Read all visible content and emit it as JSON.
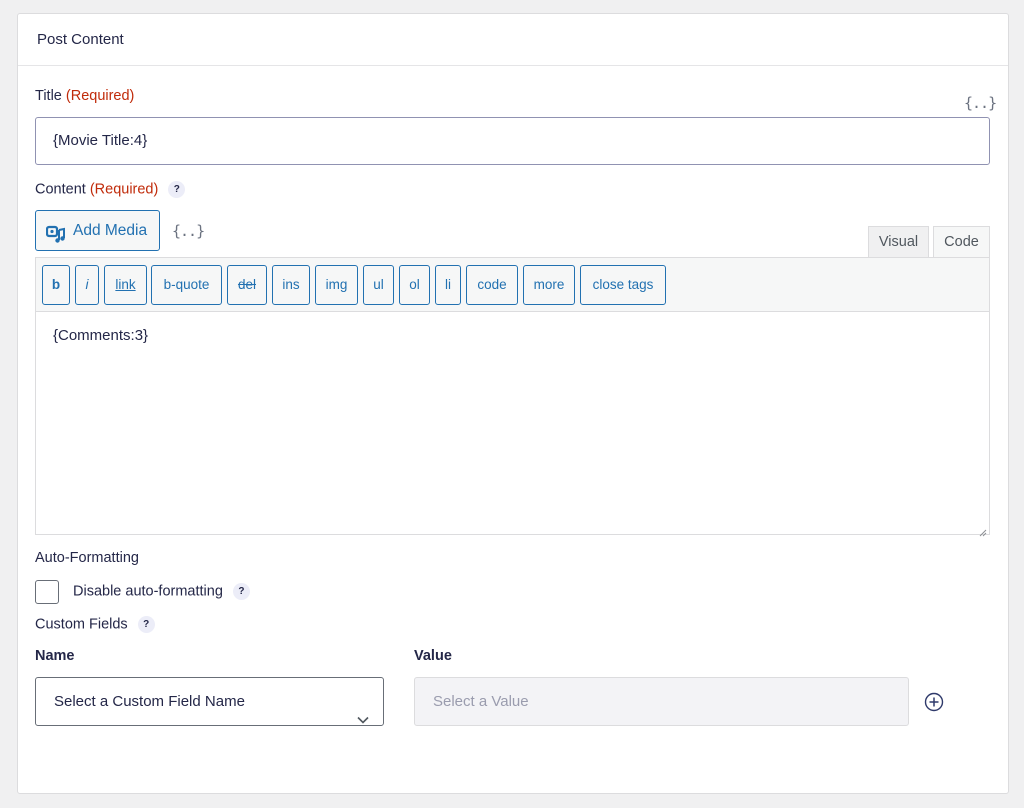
{
  "panel": {
    "title": "Post Content"
  },
  "title_field": {
    "label": "Title",
    "required": "(Required)",
    "value": "{Movie Title:4}",
    "merge_tag": "{..}"
  },
  "content_field": {
    "label": "Content",
    "required": "(Required)",
    "help": "?",
    "add_media": "Add Media",
    "merge_tag": "{..}",
    "tabs": {
      "visual": "Visual",
      "code": "Code"
    },
    "quicktags": [
      "b",
      "i",
      "link",
      "b-quote",
      "del",
      "ins",
      "img",
      "ul",
      "ol",
      "li",
      "code",
      "more",
      "close tags"
    ],
    "value": "{Comments:3}"
  },
  "auto_formatting": {
    "label": "Auto-Formatting",
    "checkbox_label": "Disable auto-formatting",
    "checked": false,
    "help": "?"
  },
  "custom_fields": {
    "label": "Custom Fields",
    "help": "?",
    "name_header": "Name",
    "value_header": "Value",
    "name_selected": "Select a Custom Field Name",
    "value_placeholder": "Select a Value"
  },
  "icons": {
    "media": "add-media-icon",
    "chevron": "chevron-down-icon",
    "add": "plus-circle-icon"
  },
  "colors": {
    "accent": "#2271b1",
    "required": "#c02b0a",
    "text": "#242748"
  }
}
